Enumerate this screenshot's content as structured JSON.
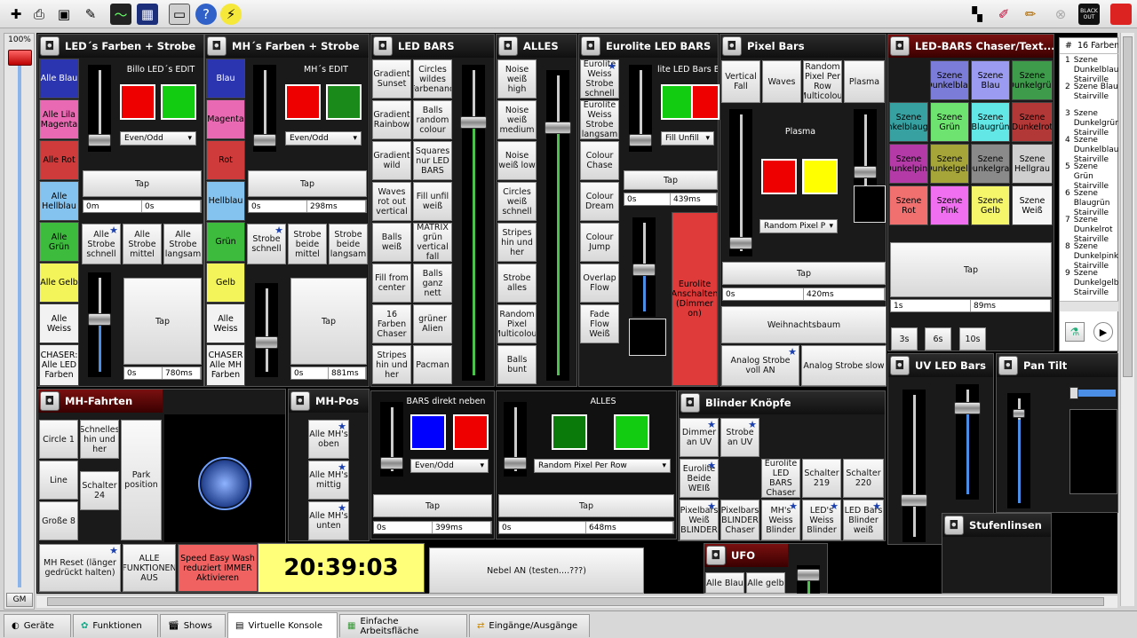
{
  "toolbar": {
    "icons": [
      "new-file-icon",
      "print-icon",
      "save-icon",
      "edit-tools-icon",
      "monitor-icon",
      "dmx-grid-icon",
      "live-view-icon",
      "help-icon",
      "lightning-icon"
    ],
    "right_icons": [
      "palette-icon",
      "brush-icon",
      "pencil-icon",
      "stop-grey-icon"
    ],
    "blackout": "BLACK OUT"
  },
  "gm": {
    "percent": "100%",
    "label": "GM",
    "level": 1.0
  },
  "frames": {
    "led_farben": {
      "title": "LED´s Farben + Strobe",
      "colors": [
        "Alle Blau",
        "Alle Lila Magenta",
        "Alle Rot",
        "Alle Hellblau",
        "Alle Grün",
        "Alle Gelb",
        "Alle Weiss",
        "CHASER: Alle LED Farben"
      ],
      "wtitle": "Billo LED´s EDIT",
      "dd": "Even/Odd",
      "tap": "Tap",
      "t1": "0m",
      "t2": "0s",
      "strobe": [
        "Alle Strobe schnell",
        "Alle Strobe mittel",
        "Alle Strobe langsam"
      ],
      "tap2": "Tap",
      "t3": "0s",
      "t4": "780ms"
    },
    "mh_farben": {
      "title": "MH´s Farben + Strobe",
      "colors": [
        "Blau",
        "Magenta",
        "Rot",
        "Hellblau",
        "Grün",
        "Gelb",
        "Alle Weiss",
        "CHASER Alle MH Farben"
      ],
      "wtitle": "MH´s EDIT",
      "dd": "Even/Odd",
      "tap": "Tap",
      "t1": "0s",
      "t2": "298ms",
      "strobe": [
        "Strobe schnell",
        "Strobe beide mittel",
        "Strobe beide langsam"
      ],
      "tap2": "Tap",
      "t3": "0s",
      "t4": "881ms"
    },
    "led_bars": {
      "title": "LED BARS",
      "col1": [
        "Gradient Sunset",
        "Gradient Rainbow",
        "Gradient wild",
        "Waves rot out vertical",
        "Balls weiß",
        "Fill from center",
        "16 Farben Chaser",
        "Stripes hin und her"
      ],
      "col2": [
        "Circles wildes Farbenand",
        "Balls random colour",
        "Squares nur LED BARS",
        "Fill unfil weiß",
        "MATRIX grün vertical fall",
        "Balls ganz nett",
        "grüner Alien",
        "Pacman"
      ]
    },
    "alles": {
      "title": "ALLES",
      "col": [
        "Noise weiß high",
        "Noise weiß medium",
        "Noise weiß low",
        "Circles weiß schnell",
        "Stripes hin und her",
        "Strobe alles",
        "Random Pixel Multicolour",
        "Balls bunt"
      ]
    },
    "eurolite": {
      "title": "Eurolite LED BARS",
      "col": [
        "Eurolite Weiss Strobe schnell",
        "Eurolite Weiss Strobe langsam",
        "Colour Chase",
        "Colour Dream",
        "Colour Jump",
        "Overlap Flow",
        "Fade Flow Weiß"
      ],
      "wtitle": "lite LED Bars E",
      "dd": "Fill Unfill",
      "tap": "Tap",
      "t1": "0s",
      "t2": "439ms",
      "red_btn": "Eurolite Anschalten (Dimmer on)"
    },
    "pixel_bars": {
      "title": "Pixel Bars",
      "row": [
        "Vertical Fall",
        "Waves",
        "Random Pixel Per Row Multicolour",
        "Plasma"
      ],
      "wtitle": "Plasma",
      "dd": "Random Pixel P",
      "tap": "Tap",
      "t1": "0s",
      "t2": "420ms",
      "weihnacht": "Weihnachtsbaum",
      "analog1": "Analog Strobe voll AN",
      "analog2": "Analog Strobe slow"
    },
    "chaser": {
      "title": "LED-BARS Chaser/Text...",
      "scenes": [
        "Szene Dunkelblau",
        "Szene Blau",
        "Szene Dunkelgrün",
        "Szene Dunkelblaugrün",
        "Szene Grün",
        "Szene Blaugrün",
        "Szene Dunkelrot",
        "Szene Dunkelpink",
        "Szene Dunkelgelb",
        "Szene Dunkelgrau",
        "Szene Hellgrau",
        "Szene Rot",
        "Szene Pink",
        "Szene Gelb",
        "Szene Weiß"
      ],
      "tap": "Tap",
      "t1": "1s",
      "t2": "89ms",
      "times": [
        "3s",
        "6s",
        "10s"
      ]
    },
    "list": {
      "header_num": "#",
      "header_name": "16 Farben",
      "rows": [
        {
          "n": "1",
          "t": "Szene Dunkelblau Stairville"
        },
        {
          "n": "2",
          "t": "Szene Blau Stairville"
        },
        {
          "n": "3",
          "t": "Szene Dunkelgrün Stairville"
        },
        {
          "n": "4",
          "t": "Szene Dunkelblaugrün Stairville"
        },
        {
          "n": "5",
          "t": "Szene Grün Stairville"
        },
        {
          "n": "6",
          "t": "Szene Blaugrün Stairville"
        },
        {
          "n": "7",
          "t": "Szene Dunkelrot Stairville"
        },
        {
          "n": "8",
          "t": "Szene Dunkelpink Stairville"
        },
        {
          "n": "9",
          "t": "Szene Dunkelgelb Stairville"
        }
      ]
    },
    "mh_fahrten": {
      "title": "MH-Fahrten",
      "btns": [
        "Circle 1",
        "Schnelles hin und her",
        "Line",
        "Schalter 24",
        "Große 8",
        "Park position"
      ],
      "reset": "MH Reset (länger gedrückt halten)",
      "alle_fkt": "ALLE FUNKTIONEN AUS",
      "speed": "Speed Easy Wash reduziert IMMER Aktivieren",
      "clock": "20:39:03"
    },
    "mh_pos": {
      "title": "MH-Pos",
      "btns": [
        "Alle MH's oben",
        "Alle MH's mittig",
        "Alle MH's unten"
      ]
    },
    "bars_direkt": {
      "wtitle": "BARS direkt neben",
      "dd": "Even/Odd",
      "tap": "Tap",
      "t1": "0s",
      "t2": "399ms"
    },
    "alles2": {
      "wtitle": "ALLES",
      "dd": "Random Pixel Per Row",
      "tap": "Tap",
      "t1": "0s",
      "t2": "648ms"
    },
    "nebel": {
      "label": "Nebel AN (testen....???)"
    },
    "blinder": {
      "title": "Blinder Knöpfe",
      "btns": [
        "Dimmer an UV",
        "Strobe an UV",
        "Eurolite Beide WEIß",
        "Eurolite LED BARS Chaser",
        "Schalter 219",
        "Schalter 220",
        "Pixelbars Weiß BLINDER",
        "Pixelbars BLINDER Chaser",
        "MH's Weiss Blinder",
        "LED's Weiss Blinder",
        "LED Bars Blinder weiß"
      ]
    },
    "ufo": {
      "title": "UFO",
      "btns": [
        "Alle Blau",
        "Alle gelb"
      ]
    },
    "uv": {
      "title": "UV LED Bars"
    },
    "pan": {
      "title": "Pan Tilt"
    },
    "stufen": {
      "title": "Stufenlinsen"
    }
  },
  "tabs": [
    "Geräte",
    "Funktionen",
    "Shows",
    "Virtuelle Konsole",
    "Einfache Arbeitsfläche",
    "Eingänge/Ausgänge"
  ],
  "colors": {
    "blau": "#2b35b0",
    "magenta": "#e96ab2",
    "rot": "#cf3a3a",
    "hellblau": "#84c3ef",
    "gruen": "#3dbb3d",
    "gelb": "#f3f35a",
    "weiss": "#f2f2f2"
  }
}
